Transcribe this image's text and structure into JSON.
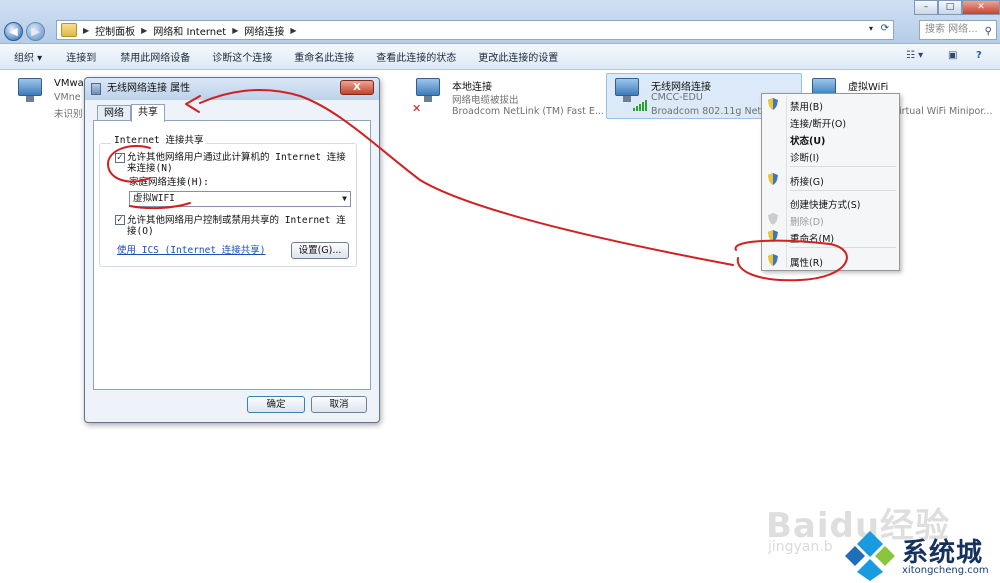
{
  "address": {
    "breadcrumb": [
      "控制面板",
      "网络和 Internet",
      "网络连接"
    ],
    "search_placeholder": "搜索 网络..."
  },
  "toolbar": {
    "items": [
      "组织 ▾",
      "连接到",
      "禁用此网络设备",
      "诊断这个连接",
      "重命名此连接",
      "查看此连接的状态",
      "更改此连接的设置"
    ]
  },
  "connections": [
    {
      "name": "VMwa",
      "line2": "VMne",
      "line3": "未识别"
    },
    {
      "name": "本地连接",
      "line2": "网络电缆被拔出",
      "line3": "Broadcom NetLink (TM) Fast E..."
    },
    {
      "name": "无线网络连接",
      "line2": "CMCC-EDU",
      "line3": "Broadcom 802.11g Netw"
    },
    {
      "name": "虚拟WiFi",
      "line2": "",
      "line3": "irtual WiFi Minipor..."
    }
  ],
  "dialog": {
    "title": "无线网络连接 属性",
    "close": "X",
    "tabs": [
      "网络",
      "共享"
    ],
    "group_title": "Internet 连接共享",
    "cb1_line1": "允许其他网络用户通过此计算机的 Internet 连接",
    "cb1_line2": "来连接(N)",
    "cb1_checked": "✓",
    "home_label": "家庭网络连接(H):",
    "home_value": "虚拟WIFI",
    "cb2_line1": "允许其他网络用户控制或禁用共享的 Internet 连",
    "cb2_line2": "接(O)",
    "cb2_checked": "✓",
    "ics_link": "使用 ICS (Internet 连接共享)",
    "settings_btn": "设置(G)...",
    "ok_btn": "确定",
    "cancel_btn": "取消"
  },
  "context_menu": {
    "items": [
      {
        "label": "禁用(B)",
        "shield": true,
        "disabled": false
      },
      {
        "label": "连接/断开(O)",
        "shield": false,
        "disabled": false
      },
      {
        "label": "状态(U)",
        "shield": false,
        "disabled": false
      },
      {
        "label": "诊断(I)",
        "shield": false,
        "disabled": false
      },
      {
        "label": "桥接(G)",
        "shield": true,
        "disabled": false
      },
      {
        "label": "创建快捷方式(S)",
        "shield": false,
        "disabled": false
      },
      {
        "label": "删除(D)",
        "shield": true,
        "disabled": true
      },
      {
        "label": "重命名(M)",
        "shield": true,
        "disabled": false
      },
      {
        "label": "属性(R)",
        "shield": true,
        "disabled": false
      }
    ]
  },
  "watermark": {
    "baidu": "Baidu经验",
    "jingyan": "jingyan.b",
    "site": "系统城",
    "site_url": "xitongcheng.com"
  },
  "colors": {
    "annotation": "#d21f1f",
    "accent": "#3f73c0",
    "site_brand": "#15325c"
  },
  "icons": [
    "back-arrow-icon",
    "forward-arrow-icon",
    "folder-icon",
    "search-icon",
    "network-pc-icon",
    "uac-shield-icon",
    "disconnected-x-icon",
    "signal-bars-icon"
  ]
}
